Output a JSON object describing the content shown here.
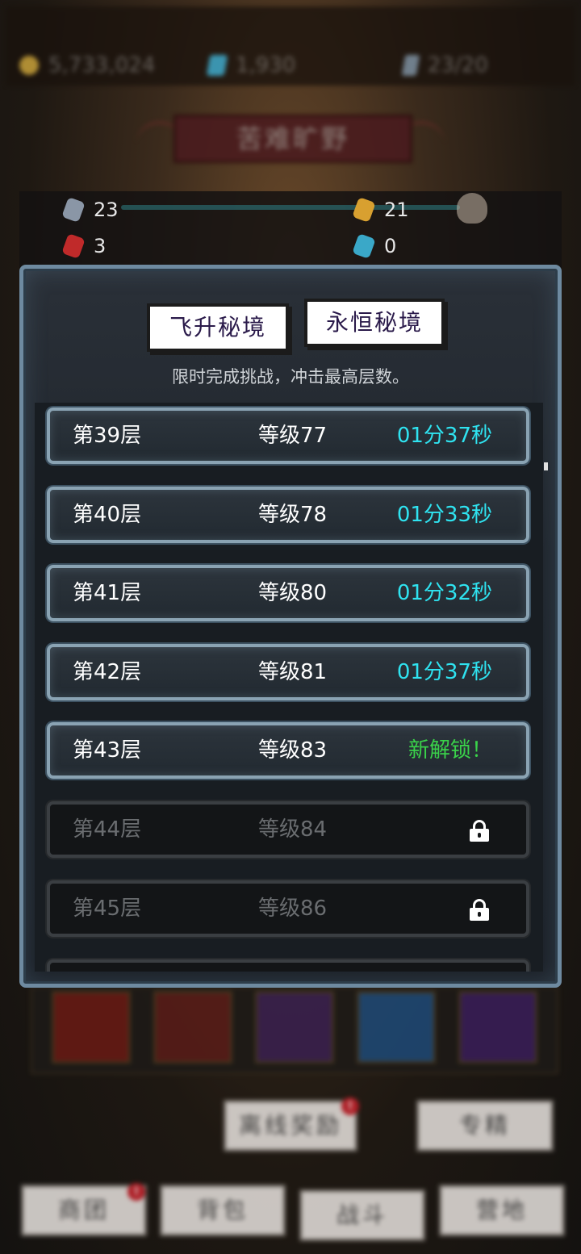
{
  "resources": {
    "gold": "5,733,024",
    "gems": "1,930",
    "stamina": "23/20"
  },
  "region_title": "苦难旷野",
  "stats": [
    {
      "icon": "grey-rune-icon",
      "color": "#8a96a6",
      "value": "23"
    },
    {
      "icon": "gold-rune-icon",
      "color": "#d8a030",
      "value": "21"
    },
    {
      "icon": "red-rune-icon",
      "color": "#c02a2a",
      "value": "3"
    },
    {
      "icon": "blue-rune-icon",
      "color": "#3aa8c8",
      "value": "0"
    }
  ],
  "dialog": {
    "tabs": [
      "飞升秘境",
      "永恒秘境"
    ],
    "subtitle": "限时完成挑战，冲击最高层数。",
    "rows": [
      {
        "floor": "第39层",
        "level": "等级77",
        "status": "01分37秒",
        "state": "cleared"
      },
      {
        "floor": "第40层",
        "level": "等级78",
        "status": "01分33秒",
        "state": "cleared"
      },
      {
        "floor": "第41层",
        "level": "等级80",
        "status": "01分32秒",
        "state": "cleared"
      },
      {
        "floor": "第42层",
        "level": "等级81",
        "status": "01分37秒",
        "state": "cleared"
      },
      {
        "floor": "第43层",
        "level": "等级83",
        "status": "新解锁！",
        "state": "unlocked"
      },
      {
        "floor": "第44层",
        "level": "等级84",
        "status": "",
        "state": "locked"
      },
      {
        "floor": "第45层",
        "level": "等级86",
        "status": "",
        "state": "locked"
      },
      {
        "floor": "",
        "level": "",
        "status": "",
        "state": "locked"
      }
    ]
  },
  "bottom_buttons": {
    "offline_reward": "离线奖励",
    "specialize": "专精"
  },
  "nav": {
    "guild": "商团",
    "backpack": "背包",
    "battle": "战斗",
    "camp": "营地"
  },
  "badges": {
    "notice": "!"
  },
  "colors": {
    "time_cyan": "#2fe3f0",
    "new_green": "#3ad24a",
    "tab_text": "#2a1a4a"
  }
}
